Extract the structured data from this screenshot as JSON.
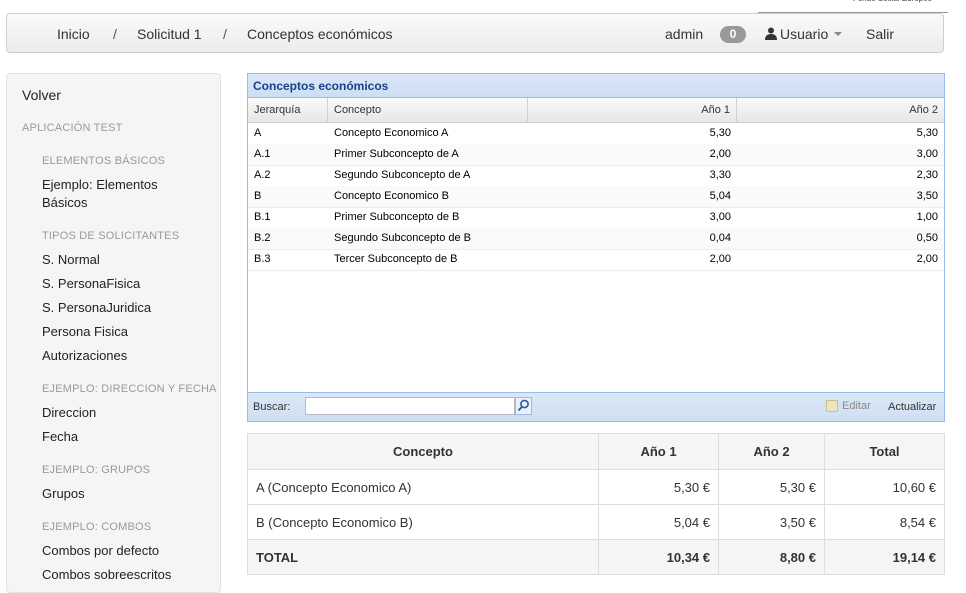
{
  "navbar": {
    "breadcrumbs": [
      "Inicio",
      "Solicitud 1",
      "Conceptos económicos"
    ],
    "separator": "/",
    "admin": "admin",
    "badge": "0",
    "user": "Usuario",
    "logout": "Salir"
  },
  "sidebar": {
    "back": "Volver",
    "app_header": "APLICACIÓN TEST",
    "sections": [
      {
        "header": "ELEMENTOS BÁSICOS",
        "items": [
          "Ejemplo: Elementos Básicos"
        ]
      },
      {
        "header": "TIPOS DE SOLICITANTES",
        "items": [
          "S. Normal",
          "S. PersonaFisica",
          "S. PersonaJuridica",
          "Persona Fisica",
          "Autorizaciones"
        ]
      },
      {
        "header": "EJEMPLO: DIRECCION Y FECHA",
        "items": [
          "Direccion",
          "Fecha"
        ]
      },
      {
        "header": "EJEMPLO: GRUPOS",
        "items": [
          "Grupos"
        ]
      },
      {
        "header": "EJEMPLO: COMBOS",
        "items": [
          "Combos por defecto",
          "Combos sobreescritos"
        ]
      }
    ]
  },
  "grid": {
    "title": "Conceptos económicos",
    "columns": [
      "Jerarquía",
      "Concepto",
      "Año 1",
      "Año 2"
    ],
    "rows": [
      [
        "A",
        "Concepto Economico A",
        "5,30",
        "5,30"
      ],
      [
        "A.1",
        "Primer Subconcepto de A",
        "2,00",
        "3,00"
      ],
      [
        "A.2",
        "Segundo Subconcepto de A",
        "3,30",
        "2,30"
      ],
      [
        "B",
        "Concepto Economico B",
        "5,04",
        "3,50"
      ],
      [
        "B.1",
        "Primer Subconcepto de B",
        "3,00",
        "1,00"
      ],
      [
        "B.2",
        "Segundo Subconcepto de B",
        "0,04",
        "0,50"
      ],
      [
        "B.3",
        "Tercer Subconcepto de B",
        "2,00",
        "2,00"
      ]
    ],
    "search_label": "Buscar:",
    "search_value": "",
    "edit_label": "Editar",
    "refresh_label": "Actualizar"
  },
  "totals": {
    "columns": [
      "Concepto",
      "Año 1",
      "Año 2",
      "Total"
    ],
    "rows": [
      [
        "A (Concepto Economico A)",
        "5,30 €",
        "5,30 €",
        "10,60 €"
      ],
      [
        "B (Concepto Economico B)",
        "5,04 €",
        "3,50 €",
        "8,54 €"
      ]
    ],
    "total_row": [
      "TOTAL",
      "10,34 €",
      "8,80 €",
      "19,14 €"
    ]
  }
}
